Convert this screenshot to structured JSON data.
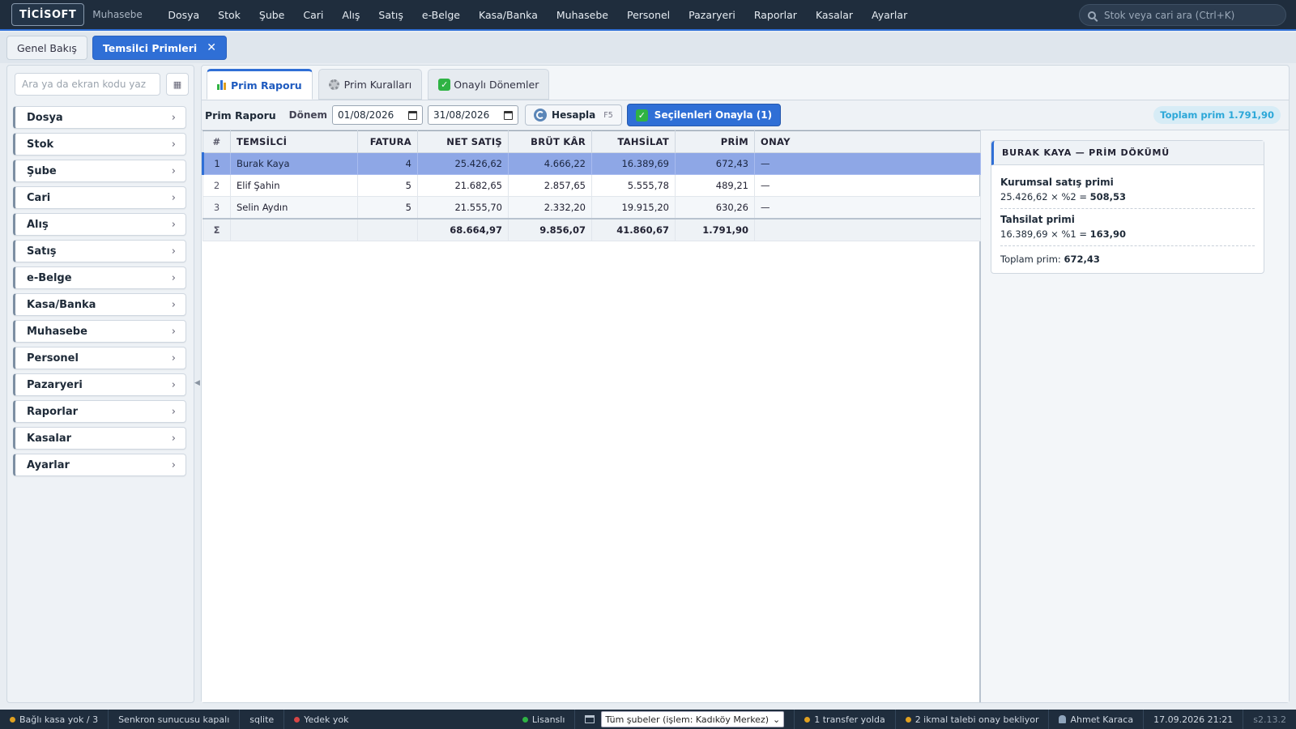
{
  "app": {
    "logo": "TİCİSOFT",
    "module": "Muhasebe",
    "menu": [
      "Dosya",
      "Stok",
      "Şube",
      "Cari",
      "Alış",
      "Satış",
      "e-Belge",
      "Kasa/Banka",
      "Muhasebe",
      "Personel",
      "Pazaryeri",
      "Raporlar",
      "Kasalar",
      "Ayarlar"
    ],
    "search_placeholder": "Stok veya cari ara (Ctrl+K)"
  },
  "tabs": {
    "inactive_label": "Genel Bakış",
    "active_label": "Temsilci Primleri",
    "close_glyph": "✕"
  },
  "sidebar": {
    "search_placeholder": "Ara ya da ekran kodu yaz",
    "items": [
      "Dosya",
      "Stok",
      "Şube",
      "Cari",
      "Alış",
      "Satış",
      "e-Belge",
      "Kasa/Banka",
      "Muhasebe",
      "Personel",
      "Pazaryeri",
      "Raporlar",
      "Kasalar",
      "Ayarlar"
    ]
  },
  "subtabs": {
    "report": "Prim Raporu",
    "rules": "Prim Kuralları",
    "approved": "Onaylı Dönemler"
  },
  "toolbar": {
    "title": "Prim Raporu",
    "period_label": "Dönem",
    "date_from": "01/08/2026",
    "date_to": "31/08/2026",
    "calc_label": "Hesapla",
    "calc_shortcut": "F5",
    "approve_label": "Seçilenleri Onayla (1)",
    "total_pill": "Toplam prim 1.791,90"
  },
  "table": {
    "headers": [
      "#",
      "TEMSİLCİ",
      "FATURA",
      "NET SATIŞ",
      "BRÜT KÂR",
      "TAHSİLAT",
      "PRİM",
      "ONAY"
    ],
    "rows": [
      [
        "1",
        "Burak Kaya",
        "4",
        "25.426,62",
        "4.666,22",
        "16.389,69",
        "672,43",
        "—"
      ],
      [
        "2",
        "Elif Şahin",
        "5",
        "21.682,65",
        "2.857,65",
        "5.555,78",
        "489,21",
        "—"
      ],
      [
        "3",
        "Selin Aydın",
        "5",
        "21.555,70",
        "2.332,20",
        "19.915,20",
        "630,26",
        "—"
      ]
    ],
    "sum": [
      "Σ",
      "",
      "",
      "68.664,97",
      "9.856,07",
      "41.860,67",
      "1.791,90",
      ""
    ]
  },
  "detail": {
    "title": "BURAK KAYA — PRİM DÖKÜMÜ",
    "block1_title": "Kurumsal satış primi",
    "block1_calc": "25.426,62 × %2 = ",
    "block1_result": "508,53",
    "block2_title": "Tahsilat primi",
    "block2_calc": "16.389,69 × %1 = ",
    "block2_result": "163,90",
    "total_label": "Toplam prim: ",
    "total_value": "672,43"
  },
  "status": {
    "kasa": "Bağlı kasa yok / 3",
    "sync": "Senkron sunucusu kapalı",
    "db": "sqlite",
    "backup": "Yedek yok",
    "license": "Lisanslı",
    "branch": "Tüm şubeler (işlem: Kadıköy Merkez)",
    "transfer": "1 transfer yolda",
    "requests": "2 ikmal talebi onay bekliyor",
    "user": "Ahmet Karaca",
    "datetime": "17.09.2026 21:21",
    "version": "s2.13.2"
  },
  "colors": {
    "accent": "#2f6fd6",
    "topbar": "#1f2d3d",
    "selected_row": "#8ea7e6",
    "status_ok": "#2fb344",
    "status_warn": "#e0a020",
    "status_err": "#d64545"
  }
}
